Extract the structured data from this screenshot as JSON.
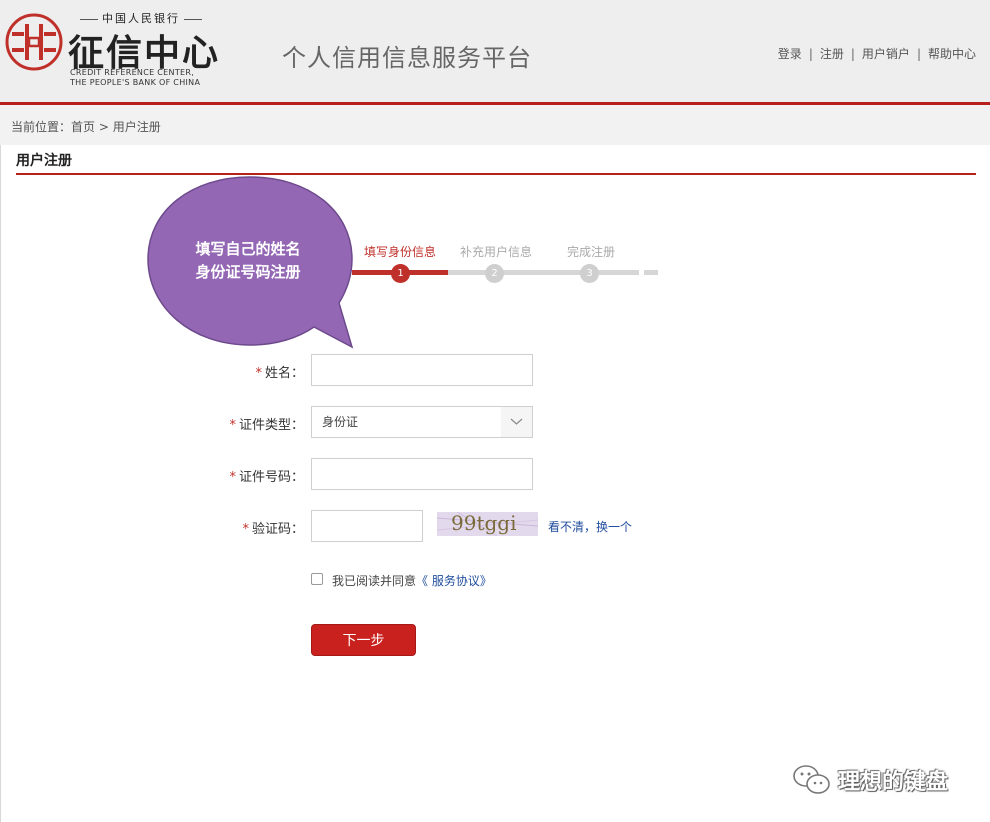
{
  "header": {
    "logo_top": "中国人民银行",
    "logo_main": "征信中心",
    "logo_en_line1": "CREDIT REFERENCE CENTER,",
    "logo_en_line2": "THE PEOPLE'S BANK OF CHINA",
    "platform_title": "个人信用信息服务平台",
    "nav": [
      "登录",
      "注册",
      "用户销户",
      "帮助中心"
    ],
    "nav_separator": "|"
  },
  "breadcrumb": {
    "prefix": "当前位置：",
    "home": "首页",
    "separator": ">",
    "current": "用户注册"
  },
  "page_title": "用户注册",
  "steps": {
    "items": [
      {
        "label": "填写身份信息",
        "number": "1",
        "state": "active"
      },
      {
        "label": "补充用户信息",
        "number": "2",
        "state": "inactive"
      },
      {
        "label": "完成注册",
        "number": "3",
        "state": "inactive"
      }
    ]
  },
  "annotation": {
    "line1": "填写自己的姓名",
    "line2": "身份证号码注册"
  },
  "form": {
    "required_mark": "*",
    "name_label": "姓名：",
    "name_value": "",
    "id_type_label": "证件类型：",
    "id_type_value": "身份证",
    "id_number_label": "证件号码：",
    "id_number_value": "",
    "captcha_label": "验证码：",
    "captcha_value": "",
    "captcha_image_text": "99tggi",
    "refresh_text": "看不清，换一个",
    "agree_text": "我已阅读并同意",
    "agree_link": "《 服务协议》",
    "agree_checked": false,
    "next_button": "下一步"
  },
  "watermark": {
    "text": "理想的键盘"
  },
  "colors": {
    "brand_red": "#c9221e",
    "link_blue": "#1f4c9c",
    "bubble_purple": "#9467b5"
  }
}
